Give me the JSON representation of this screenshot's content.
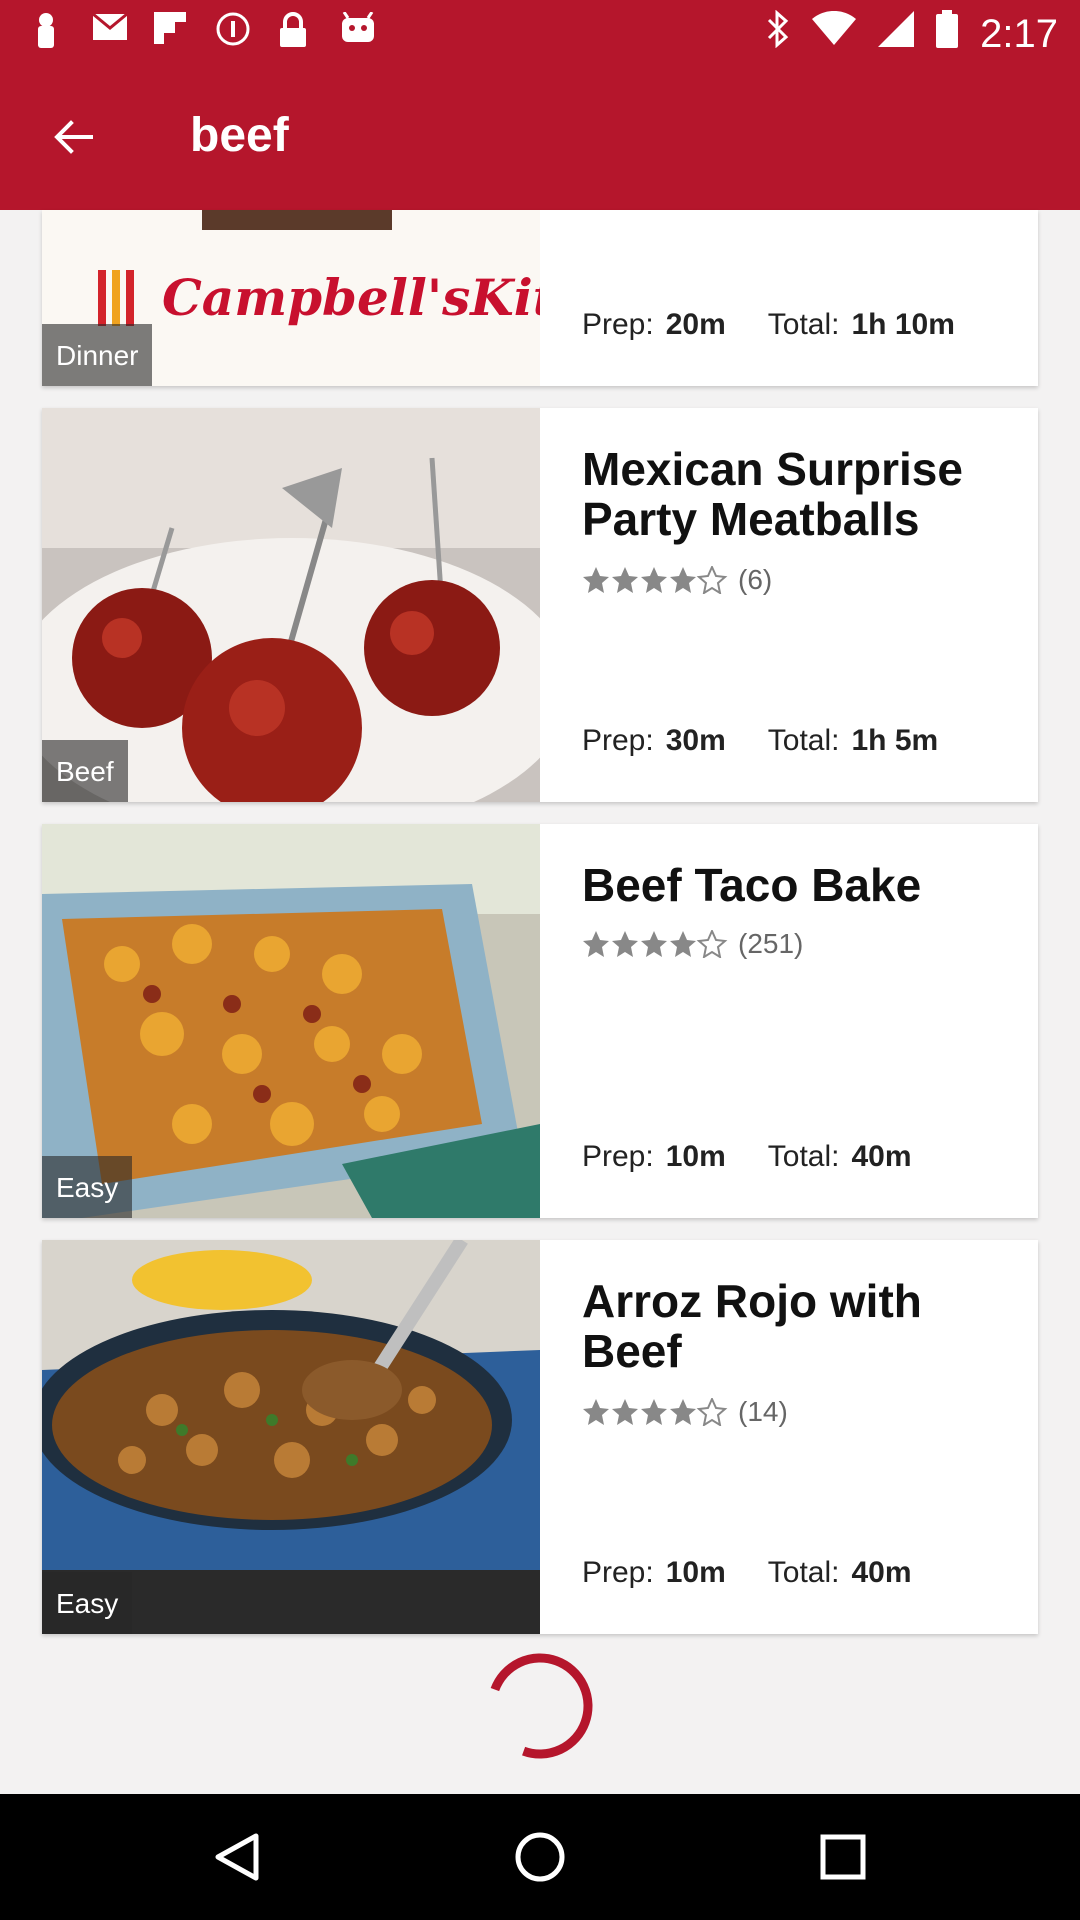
{
  "status_bar": {
    "time": "2:17",
    "left_icons": [
      "notification-icon",
      "gmail-icon",
      "flipboard-icon",
      "info-icon",
      "lock-icon",
      "android-icon"
    ],
    "right_icons": [
      "bluetooth-icon",
      "wifi-icon",
      "signal-icon",
      "battery-icon"
    ]
  },
  "app_bar": {
    "title": "beef",
    "back_icon": "arrow-left-icon"
  },
  "recipes": [
    {
      "tag": "Dinner",
      "brand_logo": "Campbell'sKitchen",
      "title": "",
      "rating_count": "",
      "prep_label": "Prep:",
      "prep_value": "20m",
      "total_label": "Total:",
      "total_value": "1h 10m"
    },
    {
      "tag": "Beef",
      "title": "Mexican Surprise Party Meatballs",
      "rating_count": "(6)",
      "stars": 4,
      "prep_label": "Prep:",
      "prep_value": "30m",
      "total_label": "Total:",
      "total_value": "1h 5m"
    },
    {
      "tag": "Easy",
      "title": "Beef Taco Bake",
      "rating_count": "(251)",
      "stars": 4,
      "prep_label": "Prep:",
      "prep_value": "10m",
      "total_label": "Total:",
      "total_value": "40m"
    },
    {
      "tag": "Easy",
      "title": "Arroz Rojo with Beef",
      "rating_count": "(14)",
      "stars": 4.5,
      "prep_label": "Prep:",
      "prep_value": "10m",
      "total_label": "Total:",
      "total_value": "40m"
    }
  ],
  "colors": {
    "brand_red": "#b5162c",
    "background": "#f3f2f2",
    "spinner": "#b5162c"
  },
  "nav": {
    "back_icon": "nav-back-icon",
    "home_icon": "nav-home-icon",
    "recents_icon": "nav-recents-icon"
  }
}
